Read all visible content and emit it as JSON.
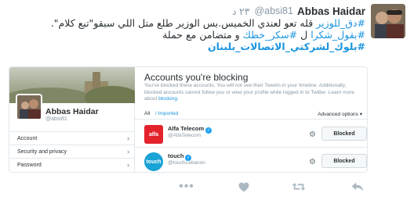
{
  "tweet": {
    "author_name": "Abbas Haidar",
    "author_handle": "@absi81",
    "time": "٢٣ د",
    "lines": [
      {
        "hashtag": "#دق_للوزير",
        "text": " قله تعو لعندي الخميس.بس الوزير طلع متل اللي سبقو\"تبع كلام\"."
      },
      {
        "hashtag": "#بقول_شكرا",
        "text": " ل ",
        "hashtag2": "#سكر_خطك",
        "text2": " و متضامن مع حملة"
      },
      {
        "hashtag": "#بلوك_لشركتي_الاتصالات_بلبنان"
      }
    ]
  },
  "embed": {
    "profile": {
      "name": "Abbas Haidar",
      "handle": "@absi81",
      "menu": [
        {
          "label": "Account",
          "chevron": "›"
        },
        {
          "label": "Security and privacy",
          "chevron": "›"
        },
        {
          "label": "Password",
          "chevron": "›"
        }
      ]
    },
    "blocking": {
      "title": "Accounts you're blocking",
      "description": "You've blocked these accounts. You will not see their Tweets in your timeline. Additionally, blocked accounts cannot follow you or view your profile while logged in to Twitter. Learn more about",
      "description_link": "blocking",
      "description_end": ".",
      "filter_all": "All",
      "filter_separator": " / ",
      "filter_imported": "Imported",
      "advanced_options": "Advanced options ▾",
      "accounts": [
        {
          "name": "Alfa Telecom",
          "handle": "@AlfaTelecom",
          "logo_text": "alfa",
          "button": "Blocked"
        },
        {
          "name": "touch",
          "handle": "@touchLebanon",
          "logo_text": "touch",
          "button": "Blocked"
        }
      ]
    }
  },
  "actions": {
    "more_icon": "more-icon",
    "like_icon": "heart-icon",
    "retweet_icon": "retweet-icon",
    "reply_icon": "reply-icon"
  },
  "colors": {
    "link": "#1b95e0",
    "text": "#292f33",
    "muted": "#8899a6",
    "alfa": "#e4222b",
    "touch": "#1aa3d6"
  }
}
